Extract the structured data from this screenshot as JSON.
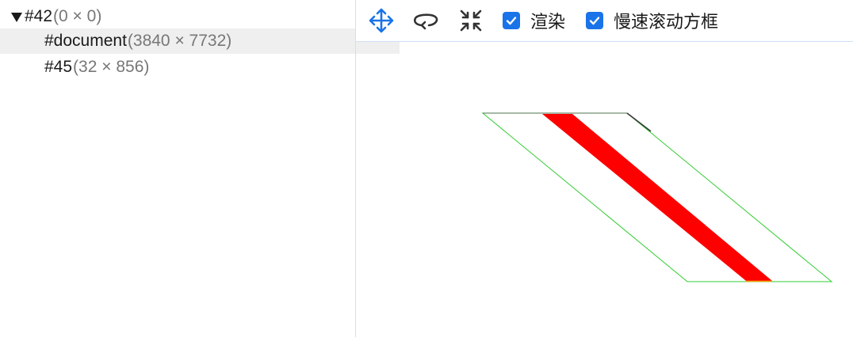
{
  "layer_tree": {
    "items": [
      {
        "name": "#42",
        "size": "(0 × 0)",
        "expanded": true,
        "selected": false
      },
      {
        "name": "#document",
        "size": "(3840 × 7732)",
        "selected": true
      },
      {
        "name": "#45",
        "size": "(32 × 856)",
        "selected": false
      }
    ]
  },
  "toolbar": {
    "tools": [
      {
        "icon": "move-icon",
        "color": "#1a73e8",
        "active": true
      },
      {
        "icon": "rotate-icon",
        "color": "#333333",
        "active": false
      },
      {
        "icon": "reset-view-icon",
        "color": "#333333",
        "active": false
      }
    ],
    "checkboxes": {
      "paint_label": "渲染",
      "paint_checked": true,
      "slow_scroll_label": "慢速滚动方框",
      "slow_scroll_checked": true
    },
    "accent": "#1a73e8"
  },
  "viewer": {
    "layer_outline_color": "#33cc33",
    "slow_scroll_color": "#ff0000"
  }
}
